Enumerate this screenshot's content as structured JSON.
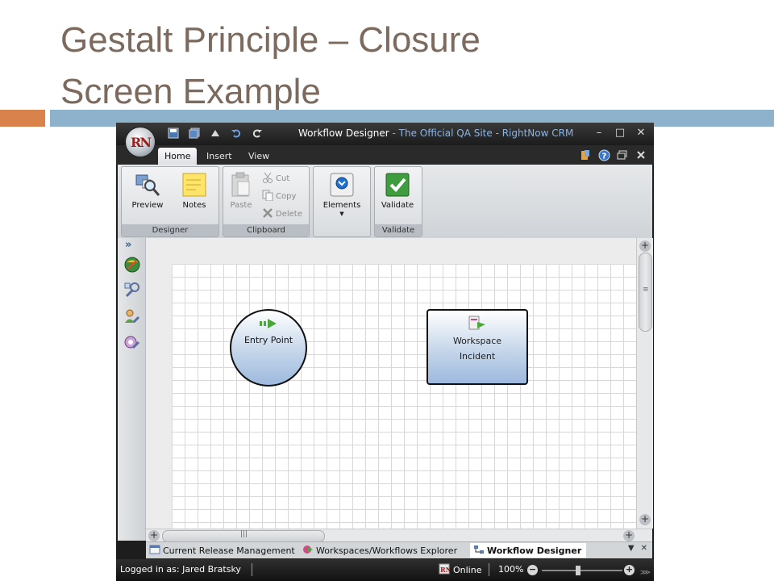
{
  "slide": {
    "title_line1": "Gestalt Principle – Closure",
    "title_line2": "Screen Example"
  },
  "window": {
    "app_logo": "RN",
    "title_main": "Workflow Designer",
    "title_sub": " - The Official QA Site - RightNow CRM",
    "quick_access_icons": [
      "save-icon",
      "save-all-icon",
      "clear-icon",
      "undo-icon",
      "redo-icon"
    ],
    "controls": [
      "–",
      "□",
      "✕"
    ]
  },
  "ribbon": {
    "tabs": [
      "Home",
      "Insert",
      "View"
    ],
    "active_tab": "Home",
    "groups": {
      "designer": {
        "label": "Designer",
        "preview": "Preview",
        "notes": "Notes"
      },
      "clipboard": {
        "label": "Clipboard",
        "paste": "Paste",
        "cut": "Cut",
        "copy": "Copy",
        "delete": "Delete"
      },
      "elements": {
        "label": "Elements"
      },
      "validate": {
        "label": "Validate",
        "validate": "Validate"
      }
    }
  },
  "canvas": {
    "nodes": {
      "entry": {
        "label": "Entry Point"
      },
      "workspace": {
        "line1": "Workspace",
        "line2": "Incident"
      }
    }
  },
  "doc_tabs": {
    "tab1": "Current Release Management",
    "tab2": "Workspaces/Workflows Explorer",
    "tab3": "Workflow Designer",
    "active": "Workflow Designer"
  },
  "statusbar": {
    "user": "Logged in as: Jared Bratsky",
    "connection": "Online",
    "zoom": "100%"
  },
  "colors": {
    "title_text": "#7b6a5d",
    "accent_orange": "#d9824b",
    "accent_blue": "#8eb1cc",
    "node_fill": "#c5d6ea"
  }
}
